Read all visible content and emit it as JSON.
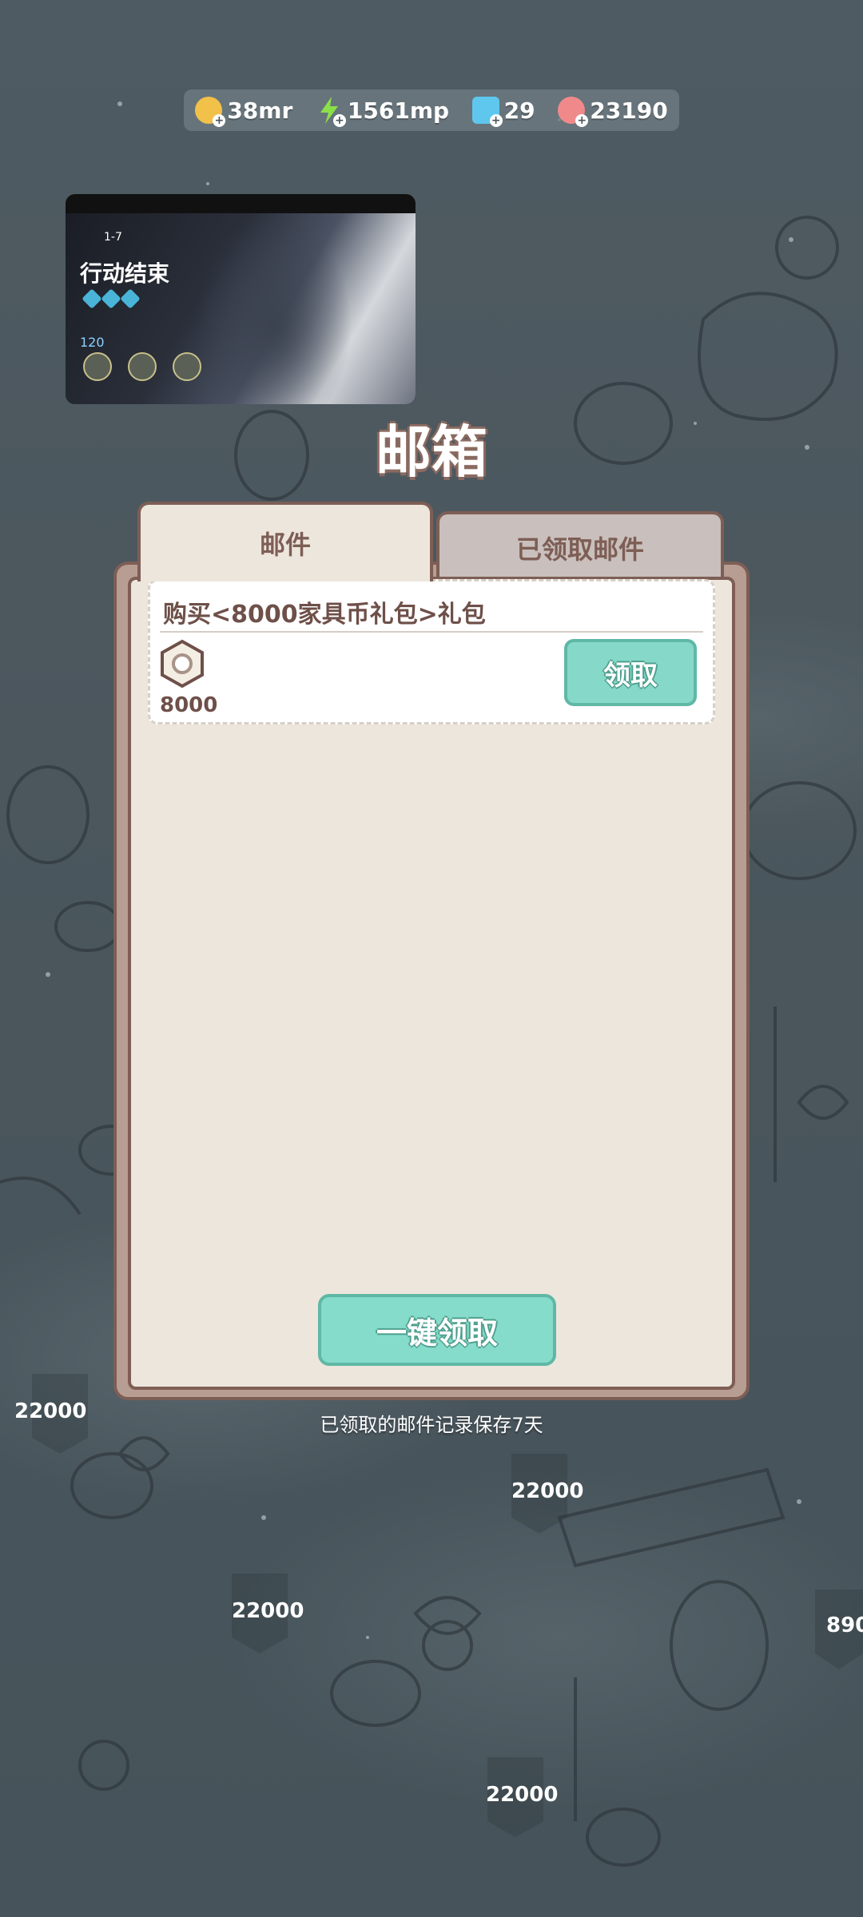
{
  "resources": [
    {
      "name": "coin",
      "value": "38mr",
      "color": "#f2c14a"
    },
    {
      "name": "energy",
      "value": "1561mp",
      "color": "#8be04a"
    },
    {
      "name": "gem",
      "value": "29",
      "color": "#5fc6ee"
    },
    {
      "name": "candy",
      "value": "23190",
      "color": "#f08a8a"
    }
  ],
  "video_thumbnail": {
    "stage": "1-7",
    "title": "行动结束",
    "count": "120"
  },
  "title": "邮箱",
  "tabs": {
    "mail": "邮件",
    "claimed": "已领取邮件"
  },
  "mail_items": [
    {
      "subject": "购买<8000家具币礼包>礼包",
      "reward_amount": "8000",
      "claim_label": "领取"
    }
  ],
  "claim_all_label": "一键领取",
  "footnote": "已领取的邮件记录保存7天",
  "background_signs": [
    "22000",
    "22000",
    "22000",
    "22000",
    "890"
  ]
}
